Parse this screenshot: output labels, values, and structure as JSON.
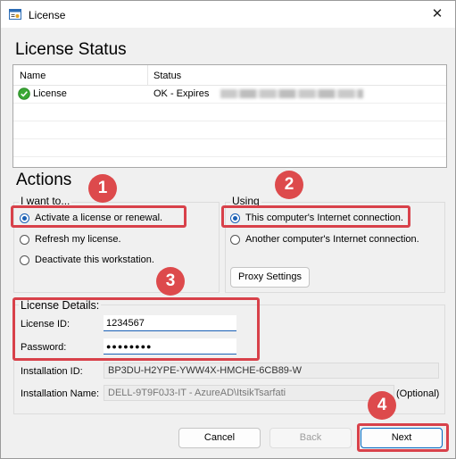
{
  "window": {
    "title": "License",
    "close_glyph": "✕"
  },
  "license_status": {
    "heading": "License Status",
    "columns": [
      "Name",
      "Status"
    ],
    "rows": [
      {
        "name": "License",
        "status": "OK - Expires"
      }
    ]
  },
  "actions": {
    "heading": "Actions",
    "i_want_to": {
      "label": "I want to...",
      "options": [
        "Activate a license or renewal.",
        "Refresh my license.",
        "Deactivate this workstation."
      ],
      "selected": 0
    },
    "using": {
      "label": "Using",
      "options": [
        "This computer's Internet connection.",
        "Another computer's Internet connection."
      ],
      "selected": 0,
      "proxy_button": "Proxy Settings"
    }
  },
  "license_details": {
    "label": "License Details:",
    "license_id_label": "License ID:",
    "license_id_value": "1234567",
    "password_label": "Password:",
    "password_value": "●●●●●●●●",
    "installation_id_label": "Installation ID:",
    "installation_id_value": "BP3DU-H2YPE-YWW4X-HMCHE-6CB89-W",
    "installation_name_label": "Installation Name:",
    "installation_name_value": "DELL-9T9F0J3-IT - AzureAD\\ItsikTsarfati",
    "optional_label": "(Optional)"
  },
  "buttons": {
    "cancel": "Cancel",
    "back": "Back",
    "next": "Next"
  },
  "callouts": [
    "1",
    "2",
    "3",
    "4"
  ],
  "colors": {
    "accent": "#1a5fb4",
    "callout": "#dd4a4c",
    "status_ok": "#3aa835"
  },
  "icons": {
    "app": "license-app-icon",
    "status": "check-circle-icon",
    "close": "close-icon"
  }
}
